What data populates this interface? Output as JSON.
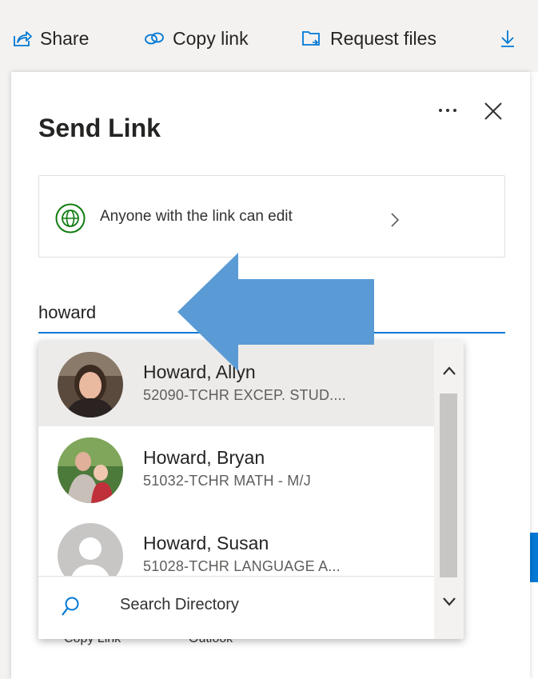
{
  "toolbar": {
    "share_label": "Share",
    "copy_link_label": "Copy link",
    "request_files_label": "Request files",
    "download_label": ""
  },
  "panel": {
    "title": "Send Link",
    "link_setting": "Anyone with the link can edit",
    "input_value": "howard",
    "bottom_options": [
      "Copy Link",
      "Outlook"
    ]
  },
  "suggestions": [
    {
      "name": "Howard, Allyn",
      "department": "52090-TCHR EXCEP. STUD....",
      "selected": true
    },
    {
      "name": "Howard, Bryan",
      "department": "51032-TCHR MATH - M/J",
      "selected": false
    },
    {
      "name": "Howard, Susan",
      "department": "51028-TCHR LANGUAGE A...",
      "selected": false
    }
  ],
  "search_directory_label": "Search Directory",
  "colors": {
    "accent": "#0078d4",
    "globe_green": "#107c10",
    "annotation_arrow": "#5b9bd5",
    "selected_row": "#edebe9"
  },
  "icons": {
    "share": "share-icon",
    "copy_link": "link-icon",
    "request_files": "folder-request-icon",
    "download": "download-icon",
    "globe": "globe-icon",
    "search": "search-icon",
    "close": "close-icon"
  }
}
